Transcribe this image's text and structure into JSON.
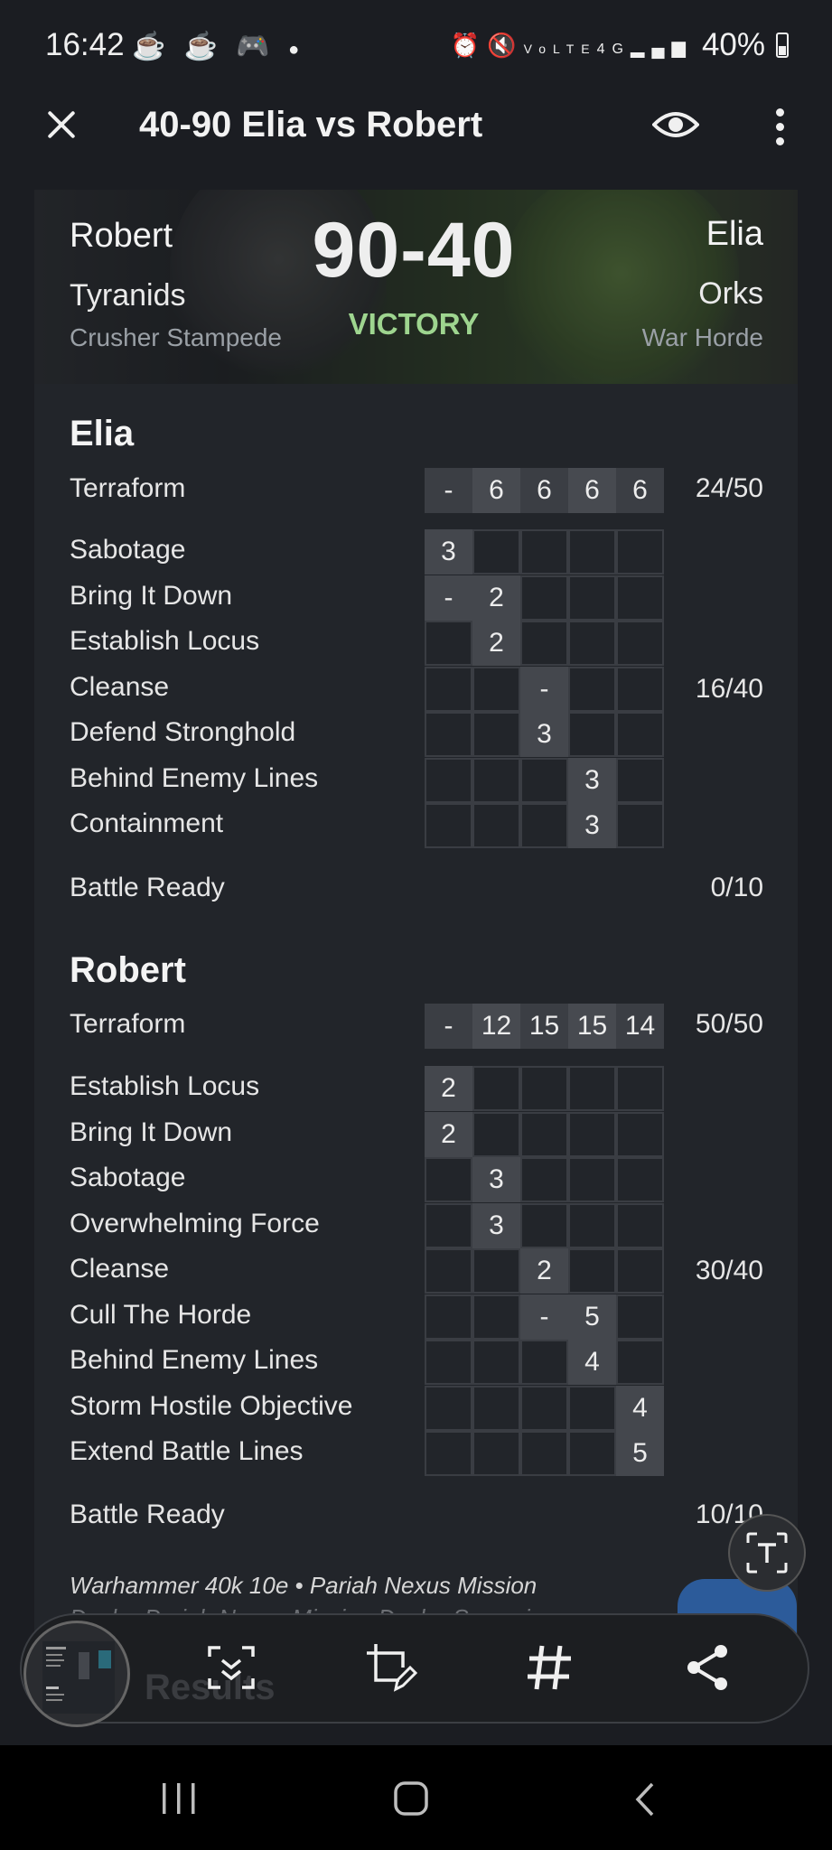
{
  "status_bar": {
    "time": "16:42",
    "left_icons": [
      "app-icon",
      "app-icon",
      "game-icon",
      "dot-icon"
    ],
    "right_icons": [
      "alarm-icon",
      "mute-icon",
      "volte-icon",
      "4g-icon",
      "signal-icon"
    ],
    "battery": "40%"
  },
  "app_bar": {
    "title": "40-90 Elia vs Robert"
  },
  "hero": {
    "left_player": "Robert",
    "left_faction": "Tyranids",
    "left_detachment": "Crusher Stampede",
    "right_player": "Elia",
    "right_faction": "Orks",
    "right_detachment": "War Horde",
    "score_left": "90",
    "score_sep": "-",
    "score_right": "40",
    "result": "VICTORY",
    "result_color": "#9ed58f"
  },
  "elia": {
    "name": "Elia",
    "terraform": {
      "label": "Terraform",
      "cells": [
        "-",
        "6",
        "6",
        "6",
        "6"
      ],
      "total": "24/50"
    },
    "secondaries": [
      {
        "label": "Sabotage",
        "cells": [
          "3",
          "",
          "",
          "",
          ""
        ]
      },
      {
        "label": "Bring It Down",
        "cells": [
          "-",
          "2",
          "",
          "",
          ""
        ]
      },
      {
        "label": "Establish Locus",
        "cells": [
          "",
          "2",
          "",
          "",
          ""
        ]
      },
      {
        "label": "Cleanse",
        "cells": [
          "",
          "",
          "-",
          "",
          ""
        ]
      },
      {
        "label": "Defend Stronghold",
        "cells": [
          "",
          "",
          "3",
          "",
          ""
        ]
      },
      {
        "label": "Behind Enemy Lines",
        "cells": [
          "",
          "",
          "",
          "3",
          ""
        ]
      },
      {
        "label": "Containment",
        "cells": [
          "",
          "",
          "",
          "3",
          ""
        ]
      }
    ],
    "secondary_total": "16/40",
    "battle_ready": {
      "label": "Battle Ready",
      "total": "0/10"
    }
  },
  "robert": {
    "name": "Robert",
    "terraform": {
      "label": "Terraform",
      "cells": [
        "-",
        "12",
        "15",
        "15",
        "14"
      ],
      "total": "50/50"
    },
    "secondaries": [
      {
        "label": "Establish Locus",
        "cells": [
          "2",
          "",
          "",
          "",
          ""
        ]
      },
      {
        "label": "Bring It Down",
        "cells": [
          "2",
          "",
          "",
          "",
          ""
        ]
      },
      {
        "label": "Sabotage",
        "cells": [
          "",
          "3",
          "",
          "",
          ""
        ]
      },
      {
        "label": "Overwhelming Force",
        "cells": [
          "",
          "3",
          "",
          "",
          ""
        ]
      },
      {
        "label": "Cleanse",
        "cells": [
          "",
          "",
          "2",
          "",
          ""
        ]
      },
      {
        "label": "Cull The Horde",
        "cells": [
          "",
          "",
          "-",
          "5",
          ""
        ]
      },
      {
        "label": "Behind Enemy Lines",
        "cells": [
          "",
          "",
          "",
          "4",
          ""
        ]
      },
      {
        "label": "Storm Hostile Objective",
        "cells": [
          "",
          "",
          "",
          "",
          "4"
        ]
      },
      {
        "label": "Extend Battle Lines",
        "cells": [
          "",
          "",
          "",
          "",
          "5"
        ]
      }
    ],
    "secondary_total": "30/40",
    "battle_ready": {
      "label": "Battle Ready",
      "total": "10/10"
    }
  },
  "footer": {
    "line1": "Warhammer 40k 10e • Pariah Nexus Mission",
    "line2": "Deck • Pariah Nexus Mission Deck • Sweeping",
    "results_heading": "Results"
  }
}
